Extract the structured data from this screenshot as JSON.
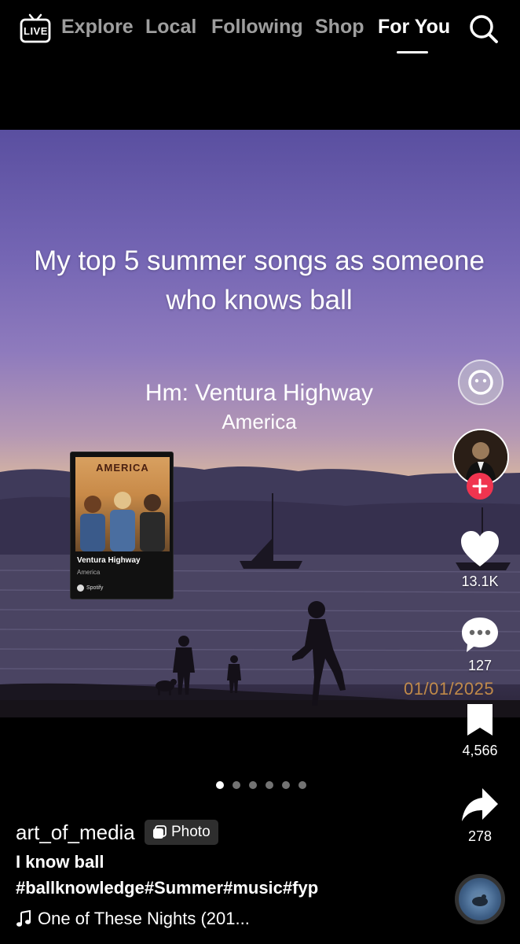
{
  "top_nav": {
    "live_label": "LIVE",
    "tabs": [
      {
        "label": "Explore"
      },
      {
        "label": "Local"
      },
      {
        "label": "Following"
      },
      {
        "label": "Shop"
      },
      {
        "label": "For You"
      }
    ],
    "active_tab": "For You"
  },
  "post": {
    "overlay_title": "My top 5 summer songs as someone who knows ball",
    "overlay_subtitle": "Hm: Ventura Highway",
    "overlay_artist": "America",
    "date_stamp": "01/01/2025",
    "spotify_card": {
      "album_title": "AMERICA",
      "track": "Ventura Highway",
      "artist": "America",
      "provider": "Spotify"
    },
    "carousel": {
      "total": 6,
      "current": 1
    }
  },
  "actions": {
    "likes": "13.1K",
    "comments": "127",
    "saves": "4,566",
    "shares": "278"
  },
  "author": {
    "username": "art_of_media",
    "badge": "Photo",
    "caption": "I know ball",
    "hashtags": "#ballknowledge#Summer#music#fyp",
    "music": "One of These Nights (201..."
  },
  "colors": {
    "follow_button": "#f0344f",
    "sky_top": "#5a4fa0",
    "sunset": "#e6c49a"
  },
  "icons": [
    "live-tv-icon",
    "search-icon",
    "reaction-face-icon",
    "plus-icon",
    "heart-icon",
    "comment-icon",
    "bookmark-icon",
    "share-arrow-icon",
    "music-note-icon",
    "photo-icon"
  ]
}
